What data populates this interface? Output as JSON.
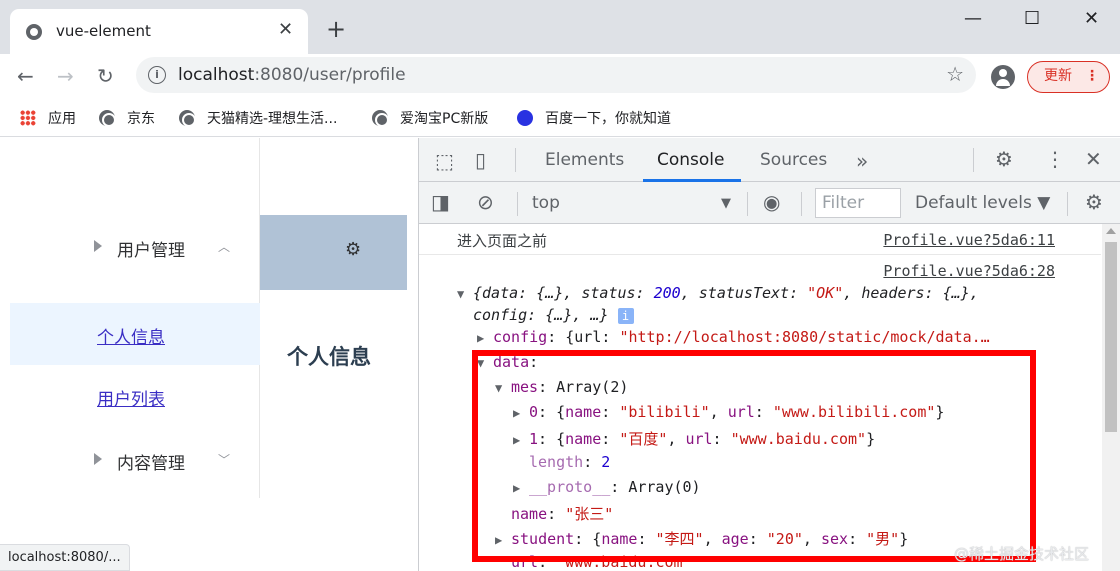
{
  "browser": {
    "tab_title": "vue-element",
    "tab_close": "✕",
    "new_tab": "+",
    "url_host": "localhost",
    "url_path": ":8080/user/profile",
    "update_label": "更新",
    "bookmarks": [
      "应用",
      "京东",
      "天猫精选-理想生活...",
      "爱淘宝PC新版",
      "百度一下，你就知道"
    ],
    "status_url": "localhost:8080/..."
  },
  "page": {
    "menu_user_mgmt": "用户管理",
    "menu_profile": "个人信息",
    "menu_user_list": "用户列表",
    "menu_content_mgmt": "内容管理",
    "title": "个人信息"
  },
  "devtools": {
    "tabs": [
      "Elements",
      "Console",
      "Sources"
    ],
    "active_tab": "Console",
    "context": "top",
    "filter_placeholder": "Filter",
    "levels": "Default levels",
    "messages": {
      "m1_text": "进入页面之前",
      "m1_src": "Profile.vue?5da6:11",
      "m2_src": "Profile.vue?5da6:28"
    },
    "response": {
      "status": "200",
      "statusText": "\"OK\"",
      "config_url": "\"http://localhost:8080/static/mock/data.…",
      "mes_length": "2",
      "items": [
        {
          "index": "0",
          "name": "\"bilibili\"",
          "url": "\"www.bilibili.com\""
        },
        {
          "index": "1",
          "name": "\"百度\"",
          "url": "\"www.baidu.com\""
        }
      ],
      "name": "\"张三\"",
      "student_name": "\"李四\"",
      "student_age": "\"20\"",
      "student_sex": "\"男\"",
      "url": "\"www.baidu.com\""
    }
  },
  "watermark": "@稀土掘金技术社区",
  "colors": {
    "highlight": "#ff0000",
    "active_tab_underline": "#1a73e8",
    "string": "#c41a16",
    "key": "#881280",
    "number": "#1c00cf"
  }
}
